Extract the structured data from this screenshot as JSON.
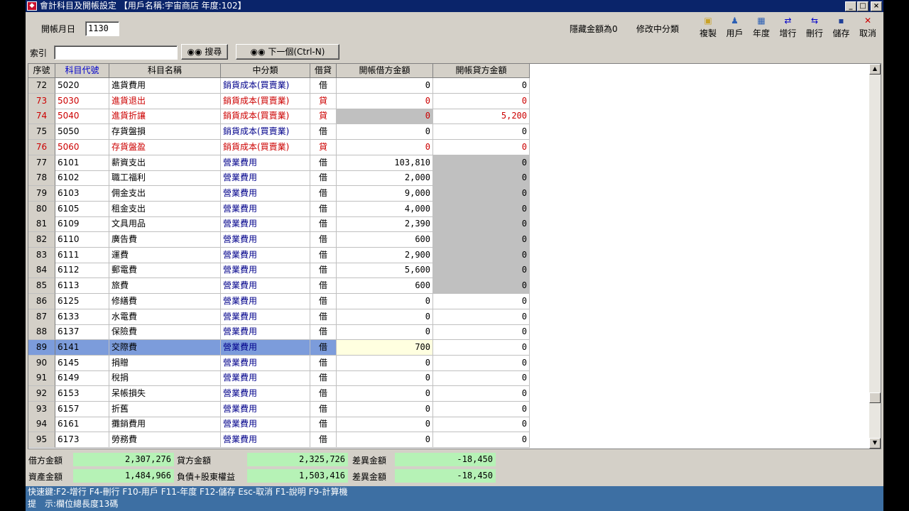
{
  "window": {
    "title": "會計科目及開帳設定 【用戶名稱:宇宙商店 年度:102】",
    "controls": [
      "_",
      "□",
      "×"
    ]
  },
  "header": {
    "open_month_label": "開帳月日",
    "open_month_value": "1130",
    "hide_zero_label": "隱藏金額為0",
    "edit_mid_label": "修改中分類"
  },
  "toolbar": [
    {
      "label": "複製",
      "icon": "copy-icon",
      "glyph": "▣",
      "color": "#c9a227"
    },
    {
      "label": "用戶",
      "icon": "user-icon",
      "glyph": "♟",
      "color": "#2b5fb4"
    },
    {
      "label": "年度",
      "icon": "calendar-icon",
      "glyph": "▦",
      "color": "#2b5fb4"
    },
    {
      "label": "增行",
      "icon": "insert-row-icon",
      "glyph": "⇄",
      "color": "#0000cc"
    },
    {
      "label": "刪行",
      "icon": "delete-row-icon",
      "glyph": "⇆",
      "color": "#0000cc"
    },
    {
      "label": "儲存",
      "icon": "save-icon",
      "glyph": "▪",
      "color": "#1f3f99"
    },
    {
      "label": "取消",
      "icon": "cancel-icon",
      "glyph": "✕",
      "color": "#cc0000"
    }
  ],
  "search": {
    "index_label": "索引",
    "index_value": "",
    "search_button": "搜尋",
    "next_button": "下一個(Ctrl-N)"
  },
  "columns": [
    "序號",
    "科目代號",
    "科目名稱",
    "中分類",
    "借貸",
    "開帳借方金額",
    "開帳貸方金額"
  ],
  "rows": [
    {
      "seq": "72",
      "code": "5020",
      "name": "進貨費用",
      "mid": "銷貨成本(買賣業)",
      "dc": "借",
      "debit": "0",
      "credit": "0",
      "red": false
    },
    {
      "seq": "73",
      "code": "5030",
      "name": "進貨退出",
      "mid": "銷貨成本(買賣業)",
      "dc": "貸",
      "debit": "0",
      "credit": "0",
      "red": true
    },
    {
      "seq": "74",
      "code": "5040",
      "name": "進貨折讓",
      "mid": "銷貨成本(買賣業)",
      "dc": "貸",
      "debit": "0",
      "credit": "5,200",
      "red": true,
      "gray_debit": true
    },
    {
      "seq": "75",
      "code": "5050",
      "name": "存貨盤損",
      "mid": "銷貨成本(買賣業)",
      "dc": "借",
      "debit": "0",
      "credit": "0",
      "red": false
    },
    {
      "seq": "76",
      "code": "5060",
      "name": "存貨盤盈",
      "mid": "銷貨成本(買賣業)",
      "dc": "貸",
      "debit": "0",
      "credit": "0",
      "red": true
    },
    {
      "seq": "77",
      "code": "6101",
      "name": "薪資支出",
      "mid": "營業費用",
      "dc": "借",
      "debit": "103,810",
      "credit": "0",
      "red": false,
      "gray_credit": true
    },
    {
      "seq": "78",
      "code": "6102",
      "name": "職工福利",
      "mid": "營業費用",
      "dc": "借",
      "debit": "2,000",
      "credit": "0",
      "red": false,
      "gray_credit": true
    },
    {
      "seq": "79",
      "code": "6103",
      "name": "佣金支出",
      "mid": "營業費用",
      "dc": "借",
      "debit": "9,000",
      "credit": "0",
      "red": false,
      "gray_credit": true
    },
    {
      "seq": "80",
      "code": "6105",
      "name": "租金支出",
      "mid": "營業費用",
      "dc": "借",
      "debit": "4,000",
      "credit": "0",
      "red": false,
      "gray_credit": true
    },
    {
      "seq": "81",
      "code": "6109",
      "name": "文具用品",
      "mid": "營業費用",
      "dc": "借",
      "debit": "2,390",
      "credit": "0",
      "red": false,
      "gray_credit": true
    },
    {
      "seq": "82",
      "code": "6110",
      "name": "廣告費",
      "mid": "營業費用",
      "dc": "借",
      "debit": "600",
      "credit": "0",
      "red": false,
      "gray_credit": true
    },
    {
      "seq": "83",
      "code": "6111",
      "name": "運費",
      "mid": "營業費用",
      "dc": "借",
      "debit": "2,900",
      "credit": "0",
      "red": false,
      "gray_credit": true
    },
    {
      "seq": "84",
      "code": "6112",
      "name": "郵電費",
      "mid": "營業費用",
      "dc": "借",
      "debit": "5,600",
      "credit": "0",
      "red": false,
      "gray_credit": true
    },
    {
      "seq": "85",
      "code": "6113",
      "name": "旅費",
      "mid": "營業費用",
      "dc": "借",
      "debit": "600",
      "credit": "0",
      "red": false,
      "gray_credit": true
    },
    {
      "seq": "86",
      "code": "6125",
      "name": "修繕費",
      "mid": "營業費用",
      "dc": "借",
      "debit": "0",
      "credit": "0",
      "red": false
    },
    {
      "seq": "87",
      "code": "6133",
      "name": "水電費",
      "mid": "營業費用",
      "dc": "借",
      "debit": "0",
      "credit": "0",
      "red": false
    },
    {
      "seq": "88",
      "code": "6137",
      "name": "保險費",
      "mid": "營業費用",
      "dc": "借",
      "debit": "0",
      "credit": "0",
      "red": false
    },
    {
      "seq": "89",
      "code": "6141",
      "name": "交際費",
      "mid": "營業費用",
      "dc": "借",
      "debit": "700",
      "credit": "0",
      "red": false,
      "selected": true
    },
    {
      "seq": "90",
      "code": "6145",
      "name": "捐贈",
      "mid": "營業費用",
      "dc": "借",
      "debit": "0",
      "credit": "0",
      "red": false
    },
    {
      "seq": "91",
      "code": "6149",
      "name": "稅捐",
      "mid": "營業費用",
      "dc": "借",
      "debit": "0",
      "credit": "0",
      "red": false
    },
    {
      "seq": "92",
      "code": "6153",
      "name": "呆帳損失",
      "mid": "營業費用",
      "dc": "借",
      "debit": "0",
      "credit": "0",
      "red": false
    },
    {
      "seq": "93",
      "code": "6157",
      "name": "折舊",
      "mid": "營業費用",
      "dc": "借",
      "debit": "0",
      "credit": "0",
      "red": false
    },
    {
      "seq": "94",
      "code": "6161",
      "name": "攤銷費用",
      "mid": "營業費用",
      "dc": "借",
      "debit": "0",
      "credit": "0",
      "red": false
    },
    {
      "seq": "95",
      "code": "6173",
      "name": "勞務費",
      "mid": "營業費用",
      "dc": "借",
      "debit": "0",
      "credit": "0",
      "red": false
    }
  ],
  "totals": {
    "debit_label": "借方金額",
    "debit_value": "2,307,276",
    "credit_label": "貸方金額",
    "credit_value": "2,325,726",
    "diff1_label": "差異金額",
    "diff1_value": "-18,450",
    "asset_label": "資產金額",
    "asset_value": "1,484,966",
    "liab_label": "負債+股東權益",
    "liab_value": "1,503,416",
    "diff2_label": "差異金額",
    "diff2_value": "-18,450"
  },
  "status": {
    "shortcuts": "快速鍵:F2-增行 F4-刪行 F10-用戶 F11-年度 F12-儲存 Esc-取消 F1-說明 F9-計算機",
    "hint": "提　示:欄位總長度13碼"
  },
  "colors": {
    "title_bar": "#0a246a",
    "selected_row": "#7c9cdb",
    "total_field": "#b6f2b6",
    "status_bar": "#3d6fa3",
    "red_text": "#cc0000",
    "mid_text": "#00008b"
  }
}
